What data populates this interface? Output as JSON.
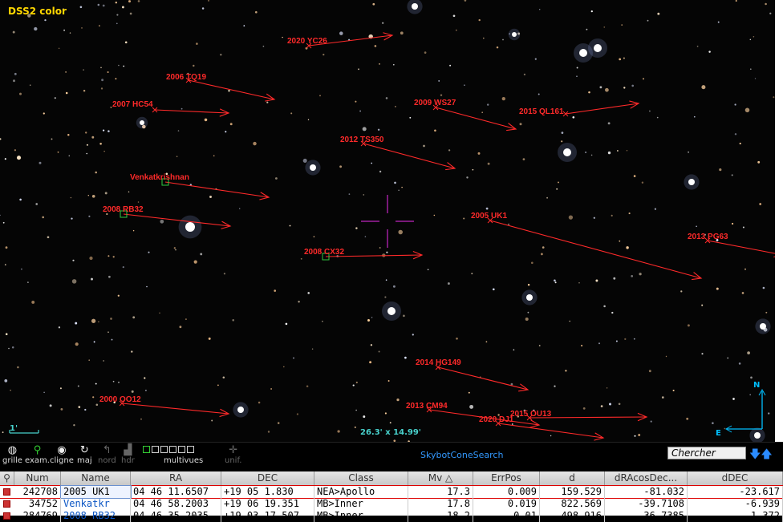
{
  "view": {
    "survey_label": "DSS2 color",
    "fov_label": "26.3' x 14.99'",
    "scale_label": "1'",
    "compass_north": "N",
    "compass_east": "E"
  },
  "asteroids": [
    {
      "label": "2020 YC26"
    },
    {
      "label": "2006 TQ19"
    },
    {
      "label": "2007 HC54"
    },
    {
      "label": "2009 WS27"
    },
    {
      "label": "2015 QL161"
    },
    {
      "label": "2012 TS350"
    },
    {
      "label": "Venkatkrishnan"
    },
    {
      "label": "2008 RB32"
    },
    {
      "label": "2005 UK1"
    },
    {
      "label": "2013 PG63"
    },
    {
      "label": "2008 CX32"
    },
    {
      "label": "2014 HG149"
    },
    {
      "label": "2000 OO12"
    },
    {
      "label": "2013 CM94"
    },
    {
      "label": "2020 DJ1"
    },
    {
      "label": "2015 OU13"
    }
  ],
  "toolbar": {
    "grid": "grille",
    "exam": "exam.",
    "blink": "cligne",
    "refresh": "maj",
    "north": "nord",
    "hdr": "hdr",
    "multiview": "multivues",
    "unif": "unif.",
    "plugin": "SkybotConeSearch",
    "search_value": "Chercher",
    "icons": [
      "grid-icon",
      "zoom-icon",
      "eye-icon",
      "refresh-icon",
      "north-icon",
      "hdr-icon",
      "multiview-icon",
      "unif-icon",
      "arrow-down-icon",
      "arrow-up-icon"
    ]
  },
  "table": {
    "columns": [
      "Num",
      "Name",
      "RA",
      "DEC",
      "Class",
      "Mv",
      "ErrPos",
      "d",
      "dRAcosDec...",
      "dDEC"
    ],
    "sort_column": "Mv",
    "rows": [
      [
        "242708",
        "2005 UK1",
        "04 46 11.6507",
        "+19 05 1.830",
        "NEA>Apollo",
        "17.3",
        "0.009",
        "159.529",
        "-81.032",
        "-23.617"
      ],
      [
        "34752",
        "Venkatkr",
        "04 46 58.2003",
        "+19 06 19.351",
        "MB>Inner",
        "17.8",
        "0.019",
        "822.569",
        "-39.7108",
        "-6.939"
      ],
      [
        "284769",
        "2008 RB32",
        "04 46 35.2035",
        "+19 03 17.507",
        "MB>Inner",
        "18.2",
        "0.01",
        "498.916",
        "-36.7385",
        "-1.372"
      ]
    ]
  },
  "colors": {
    "label_red": "#ff2a2a",
    "accent_cyan": "#48d1cc",
    "survey_yellow": "#ffd700",
    "link_blue": "#0a55c4"
  }
}
